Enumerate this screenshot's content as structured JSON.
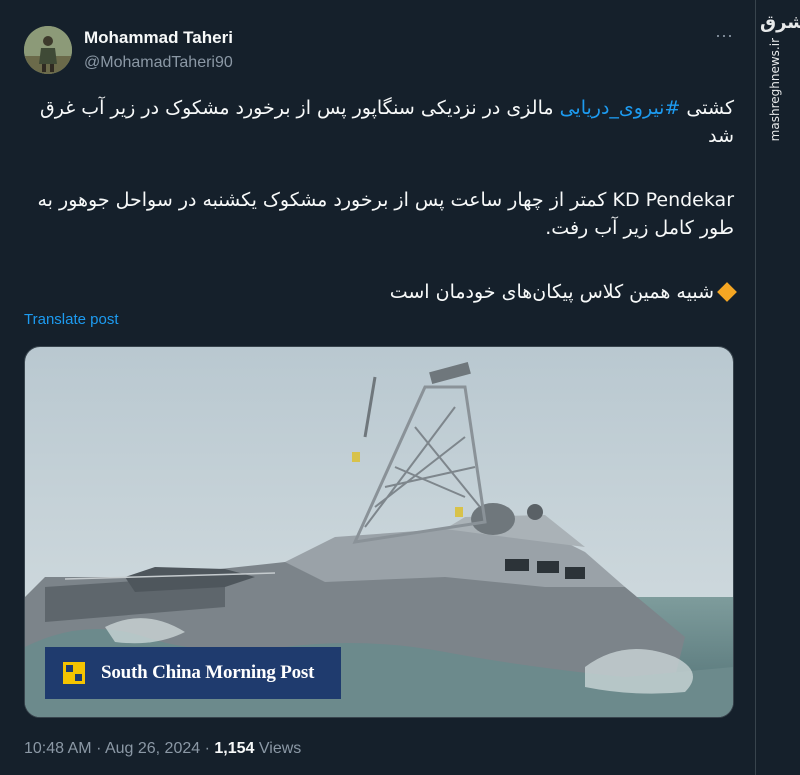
{
  "author": {
    "name": "Mohammad Taheri",
    "handle": "@MohamadTaheri90"
  },
  "tweet": {
    "p1_hashtag": "#نیروی_دریایی",
    "p1_before": "کشتی ",
    "p1_after": " مالزی در نزدیکی سنگاپور پس از برخورد مشکوک در زیر آب غرق شد",
    "p2": "KD Pendekar کمتر از چهار ساعت پس از برخورد مشکوک یکشنبه در سواحل جوهور به طور کامل زیر آب رفت.",
    "p3": "شبیه همین کلاس پیکان‌های خودمان است"
  },
  "translate_label": "Translate post",
  "media": {
    "badge_text": "South China Morning Post"
  },
  "meta": {
    "time": "10:48 AM",
    "separator": "·",
    "date": "Aug 26, 2024",
    "views_count": "1,154",
    "views_label": "Views"
  },
  "watermark": {
    "logo": "مشرق",
    "url": "mashreghnews.ir"
  },
  "icons": {
    "more": "more-dots-icon",
    "diamond": "orange-diamond-icon"
  },
  "colors": {
    "background": "#15202b",
    "link": "#1d9bf0",
    "secondary_text": "#8b98a5",
    "badge_bg": "#1f3b6e",
    "badge_logo": "#f5c400"
  }
}
